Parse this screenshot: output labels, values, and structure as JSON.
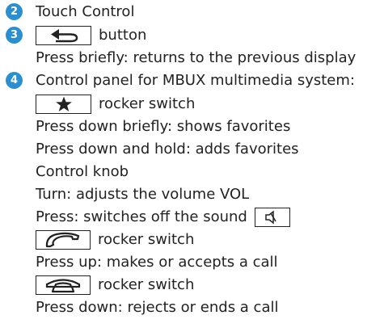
{
  "items": [
    {
      "number": "2",
      "text": "Touch Control"
    },
    {
      "number": "3",
      "suffix": "button",
      "description": "Press briefly: returns to the previous display"
    },
    {
      "number": "4",
      "text": "Control panel for MBUX multimedia system:"
    }
  ],
  "favorites": {
    "suffix": "rocker switch",
    "brief": "Press down briefly: shows favorites",
    "hold": "Press down and hold: adds favorites"
  },
  "knob": {
    "title": "Control knob",
    "turn": "Turn: adjusts the volume VOL",
    "press": "Press: switches off the sound"
  },
  "call_accept": {
    "suffix": "rocker switch",
    "description": "Press up: makes or accepts a call"
  },
  "call_end": {
    "suffix": "rocker switch",
    "description": "Press down: rejects or ends a call"
  },
  "icons": [
    "back-arrow-icon",
    "star-icon",
    "speaker-muted-icon",
    "phone-accept-icon",
    "phone-end-icon"
  ],
  "colors": {
    "number_badge": "#2a8fd0",
    "text": "#222222",
    "background": "#ffffff"
  }
}
